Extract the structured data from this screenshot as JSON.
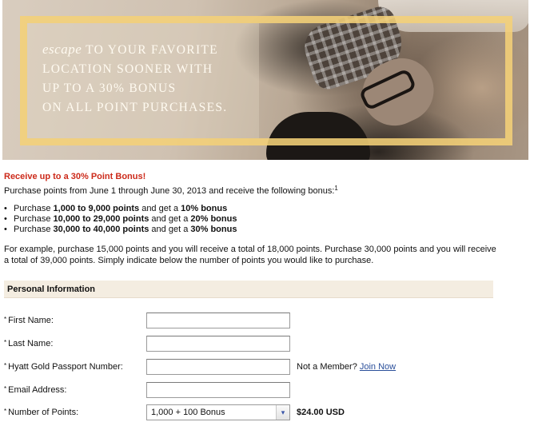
{
  "banner": {
    "line1_lead": "escape",
    "line1_rest": "TO YOUR FAVORITE",
    "line2": "LOCATION SOONER WITH",
    "line3": "UP TO A 30% BONUS",
    "line4": "ON ALL POINT PURCHASES."
  },
  "promo": {
    "headline": "Receive up to a 30% Point Bonus!",
    "intro": "Purchase points from June 1 through June 30, 2013 and receive the following bonus:",
    "intro_footnote": "1",
    "bullet_glyph": "•",
    "tiers": [
      {
        "prefix": "Purchase ",
        "range": "1,000 to 9,000 points",
        "mid": " and get a ",
        "bonus": "10% bonus"
      },
      {
        "prefix": "Purchase ",
        "range": "10,000 to 29,000 points",
        "mid": " and get a ",
        "bonus": "20% bonus"
      },
      {
        "prefix": "Purchase ",
        "range": "30,000 to 40,000 points",
        "mid": " and get a ",
        "bonus": "30% bonus"
      }
    ],
    "example": "For example, purchase 15,000 points and you will receive a total of 18,000 points. Purchase 30,000 points and you will receive a total of 39,000 points. Simply indicate below the number of points you would like to purchase."
  },
  "form": {
    "section_title": "Personal Information",
    "required_mark": "*",
    "first_name_label": "First Name:",
    "first_name_value": "",
    "last_name_label": "Last Name:",
    "last_name_value": "",
    "passport_label": "Hyatt Gold Passport Number:",
    "passport_value": "",
    "not_member_text": "Not a Member?",
    "join_now_link": "Join Now",
    "email_label": "Email Address:",
    "email_value": "",
    "points_label": "Number of Points:",
    "points_selected": "1,000 + 100 Bonus",
    "points_caret": "▾",
    "price": "$24.00 USD"
  }
}
